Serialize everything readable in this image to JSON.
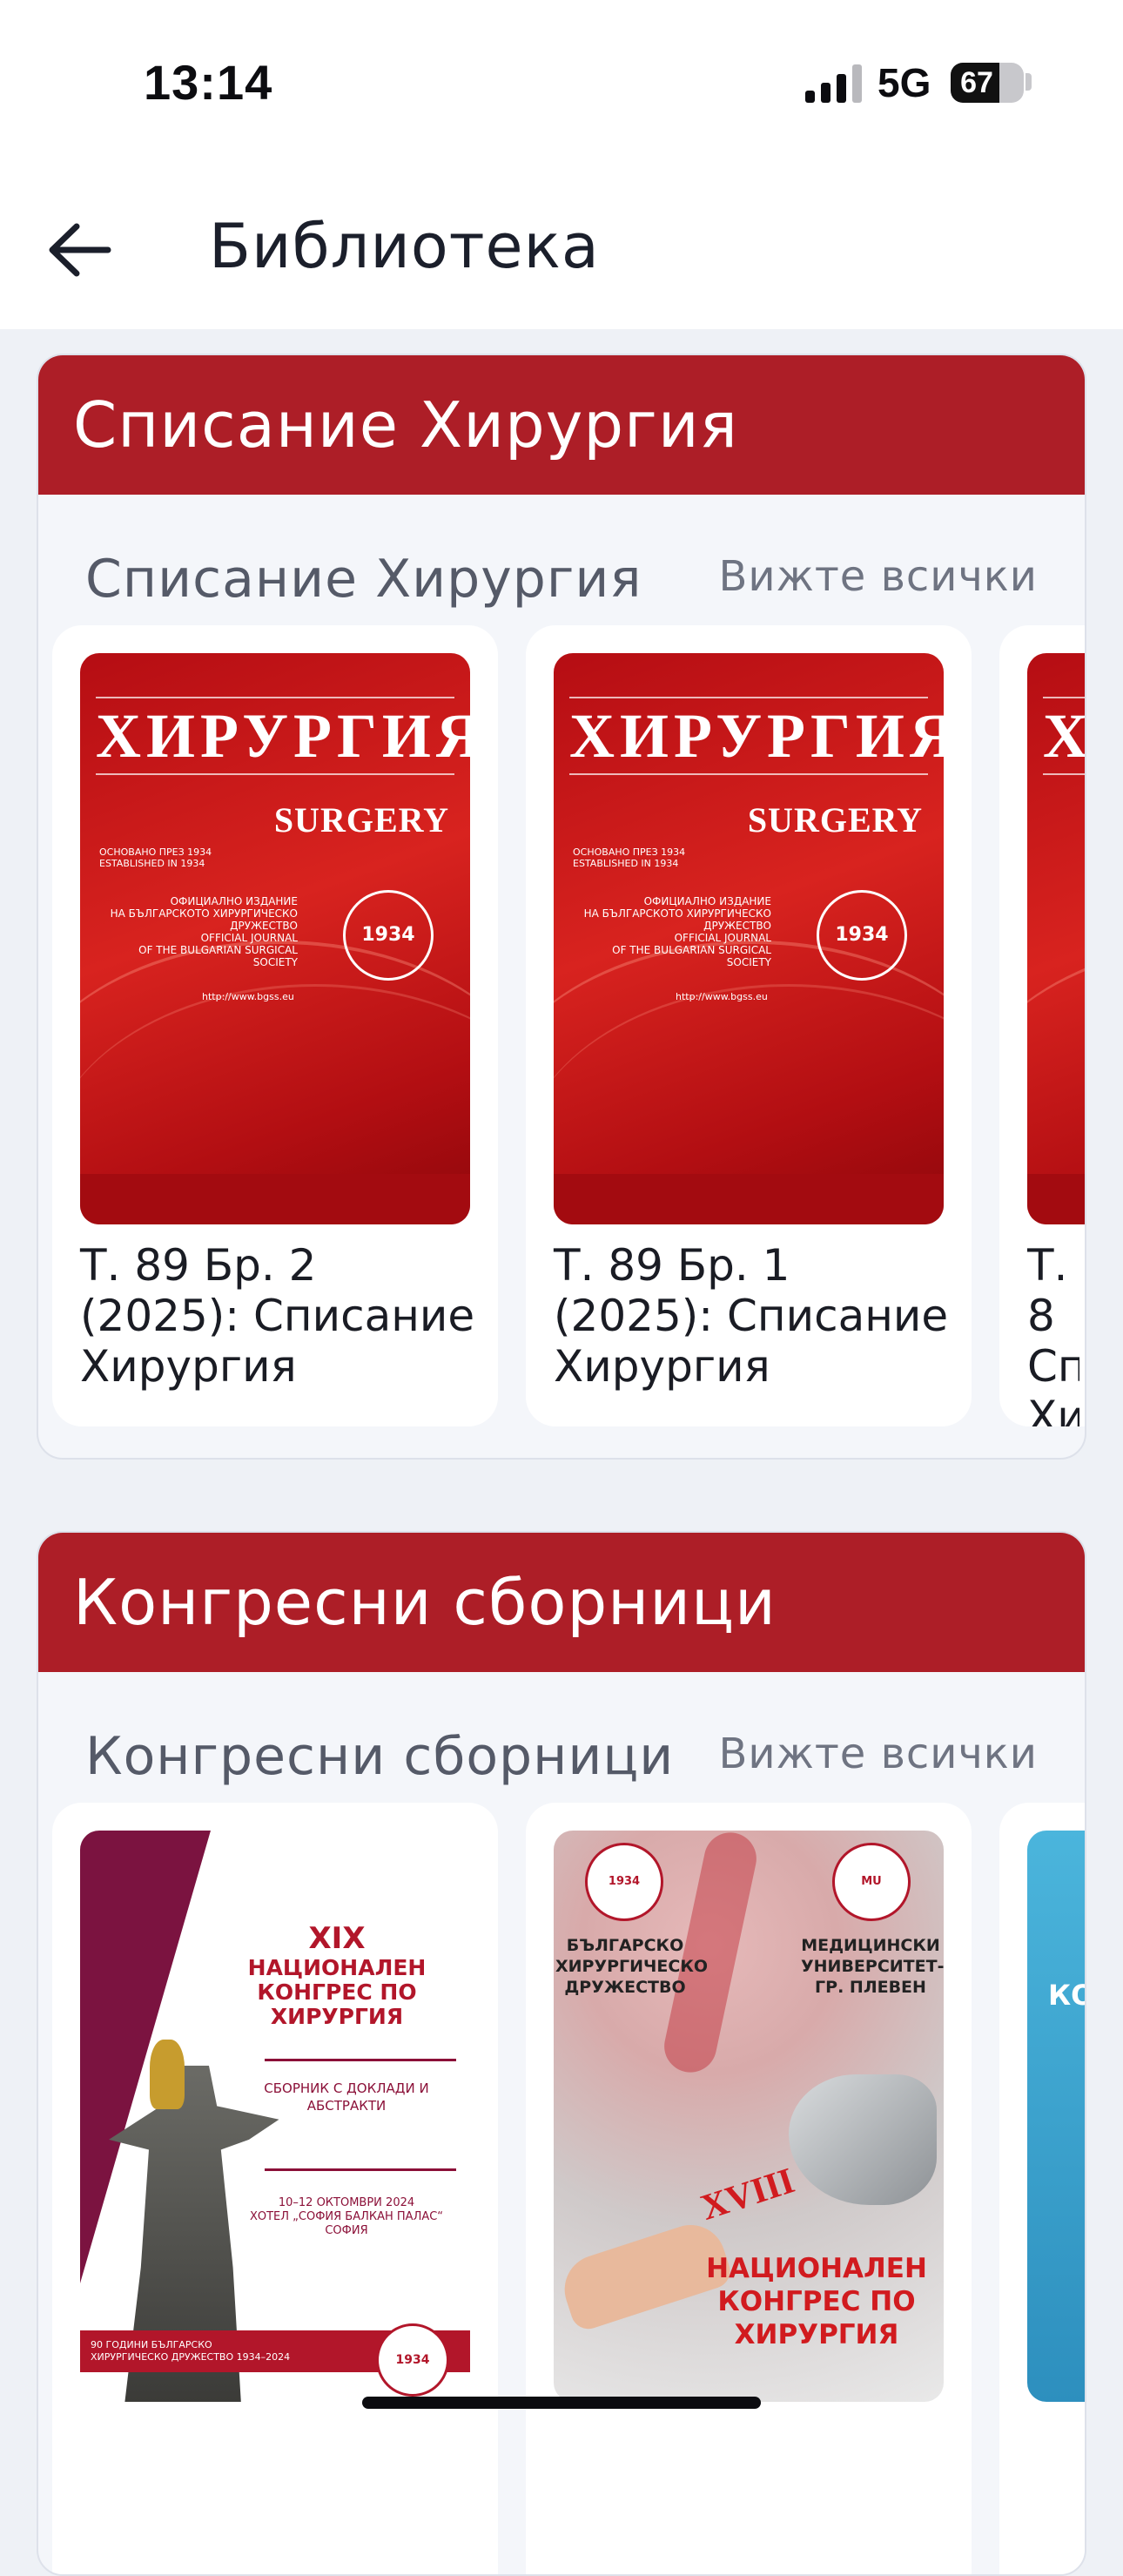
{
  "status_bar": {
    "time": "13:14",
    "network": "5G",
    "battery": "67",
    "battery_level": 0.67
  },
  "app_bar": {
    "back_icon": "back-arrow-icon",
    "title": "Библиотека"
  },
  "sections": [
    {
      "header": "Списание Хирургия",
      "row_title": "Списание Хирургия",
      "see_all": "Вижте всички",
      "items": [
        {
          "title": "Т. 89 Бр. 2 (2025): Списание Хирургия"
        },
        {
          "title": "Т. 89 Бр. 1 (2025): Списание Хирургия"
        },
        {
          "title": "Т. 8 Сп Хи"
        }
      ]
    },
    {
      "header": "Конгресни сборници",
      "row_title": "Конгресни сборници",
      "see_all": "Вижте всички",
      "items": [
        {},
        {},
        {}
      ]
    }
  ],
  "covers": {
    "surgery": {
      "title": "ХИРУРГИЯ",
      "subtitle": "SURGERY",
      "founded": "ОСНОВАНО ПРЕЗ 1934\nESTABLISHED IN 1934",
      "official": "ОФИЦИАЛНО ИЗДАНИЕ\nНА БЪЛГАРСКОТО ХИРУРГИЧЕСКО\nДРУЖЕСТВО\nOFFICIAL JOURNAL\nOF THE BULGARIAN SURGICAL\nSOCIETY",
      "seal": "1934",
      "url": "http://www.bgss.eu"
    },
    "congress_xix": {
      "roman": "XIX",
      "heading": "НАЦИОНАЛЕН КОНГРЕС ПО ХИРУРГИЯ",
      "collection": "СБОРНИК С ДОКЛАДИ И АБСТРАКТИ",
      "dates": "10–12 ОКТОМВРИ 2024\nХОТЕЛ „СОФИЯ БАЛКАН ПАЛАС“\nСОФИЯ",
      "footer": "90 ГОДИНИ БЪЛГАРСКО\nХИРУРГИЧЕСКО ДРУЖЕСТВО 1934–2024",
      "seal": "1934"
    },
    "congress_xviii": {
      "left_org": "БЪЛГАРСКО ХИРУРГИЧЕСКО ДРУЖЕСТВО",
      "right_org": "МЕДИЦИНСКИ УНИВЕРСИТЕТ- ГР. ПЛЕВЕН",
      "roman": "XVIII",
      "heading": "НАЦИОНАЛЕН КОНГРЕС ПО ХИРУРГИЯ",
      "left_logo": "1934",
      "right_logo": "MU"
    },
    "congress_blue": {
      "partial": "КОН"
    }
  },
  "colors": {
    "brand_red": "#ad1e27",
    "background": "#eef1f6",
    "card": "#ffffff"
  }
}
